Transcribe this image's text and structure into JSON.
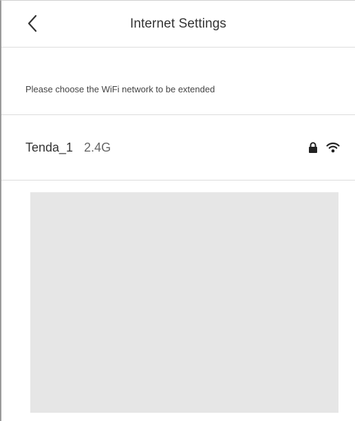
{
  "header": {
    "title": "Internet Settings",
    "back_icon": "chevron-left-icon"
  },
  "hint": {
    "text": "Please choose the WiFi network to be extended"
  },
  "networks": [
    {
      "name": "Tenda_1",
      "band": "2.4G",
      "icons": [
        "lock-icon",
        "wifi-signal-icon"
      ]
    }
  ],
  "colors": {
    "divider": "#dcdcdc",
    "panel": "#e6e6e6",
    "text": "#333333"
  }
}
